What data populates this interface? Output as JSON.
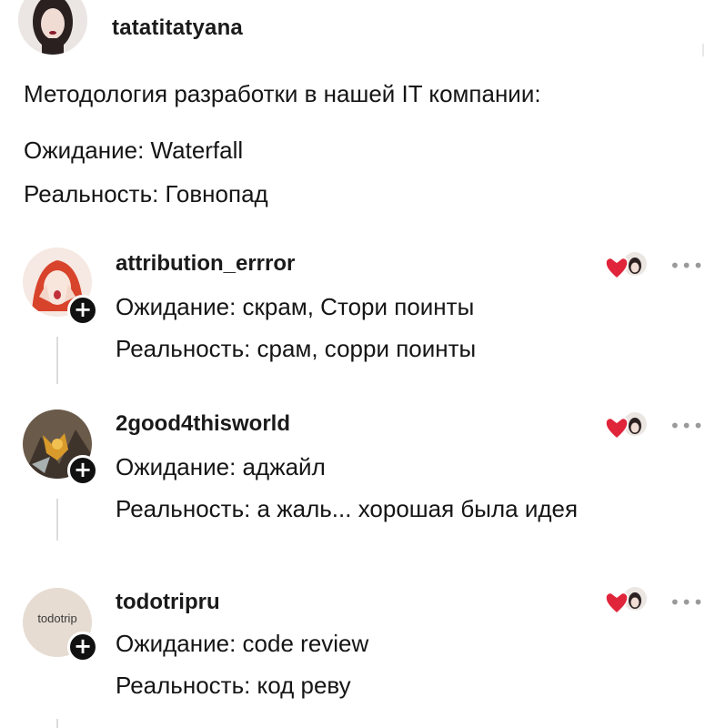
{
  "post": {
    "username": "tatatitatyana",
    "lines": [
      "Методология разработки в нашей IT компании:",
      "Ожидание: Waterfall",
      "Реальность: Говнопад"
    ]
  },
  "comments": [
    {
      "username": "attribution_errror",
      "lines": [
        "Ожидание: скрам, Стори поинты",
        "Реальность: срам, сорри поинты"
      ]
    },
    {
      "username": "2good4thisworld",
      "lines": [
        "Ожидание: аджайл",
        "Реальность: а жаль... хорошая была идея"
      ]
    },
    {
      "username": "todotripru",
      "avatar_text": "todotrip",
      "lines": [
        "Ожидание: code review",
        "Реальность: код реву"
      ]
    }
  ],
  "icons": {
    "follow": "plus-icon",
    "like": "heart-with-avatar-icon",
    "more": "more-dots-icon"
  },
  "colors": {
    "heart": "#e0243a",
    "text": "#151515",
    "muted": "#9a9a9a"
  },
  "ui": {
    "plus_glyph": "+",
    "more_glyph": "•••"
  }
}
